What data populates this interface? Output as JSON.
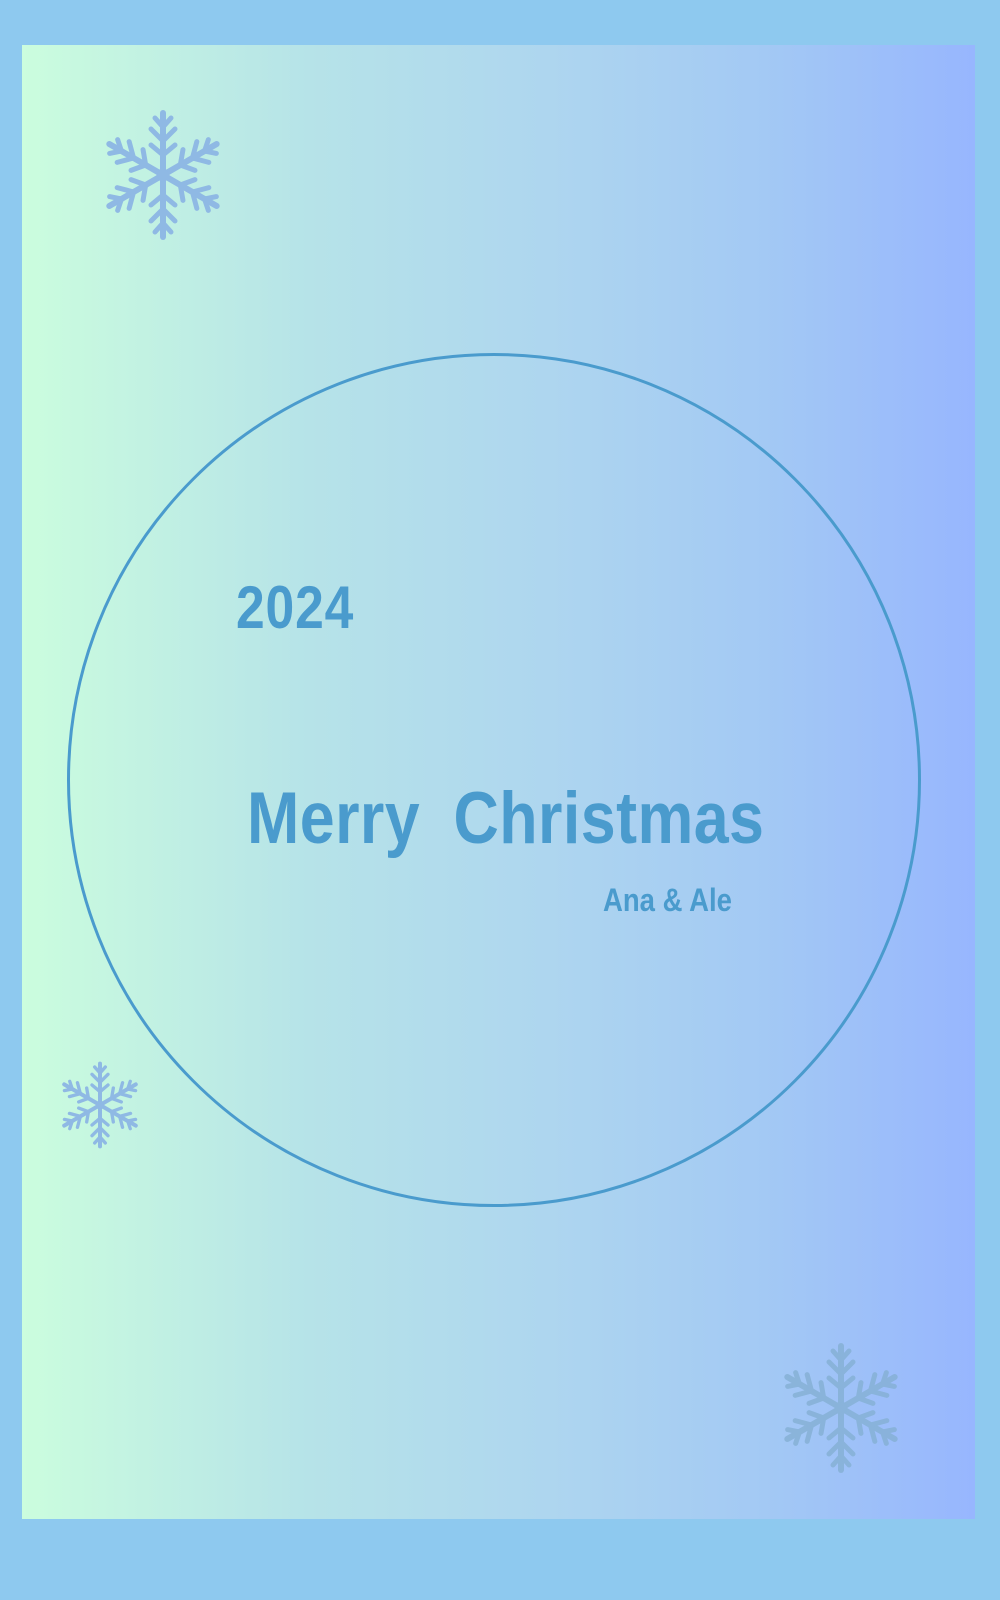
{
  "greeting": {
    "year": "2024",
    "title": "Merry Christmas",
    "signature": "Ana & Ale"
  },
  "decorations": {
    "icons": [
      "snowflake-icon",
      "snowflake-icon",
      "snowflake-icon"
    ],
    "ring": "circle-outline"
  },
  "colors": {
    "outer_background": "#8ec9ef",
    "gradient_left": "#cbfdde",
    "gradient_right": "#97b6fe",
    "text": "#4a9bcd",
    "snowflake": "#8fb9e4",
    "snowflake_faded": "#86b1d6"
  }
}
